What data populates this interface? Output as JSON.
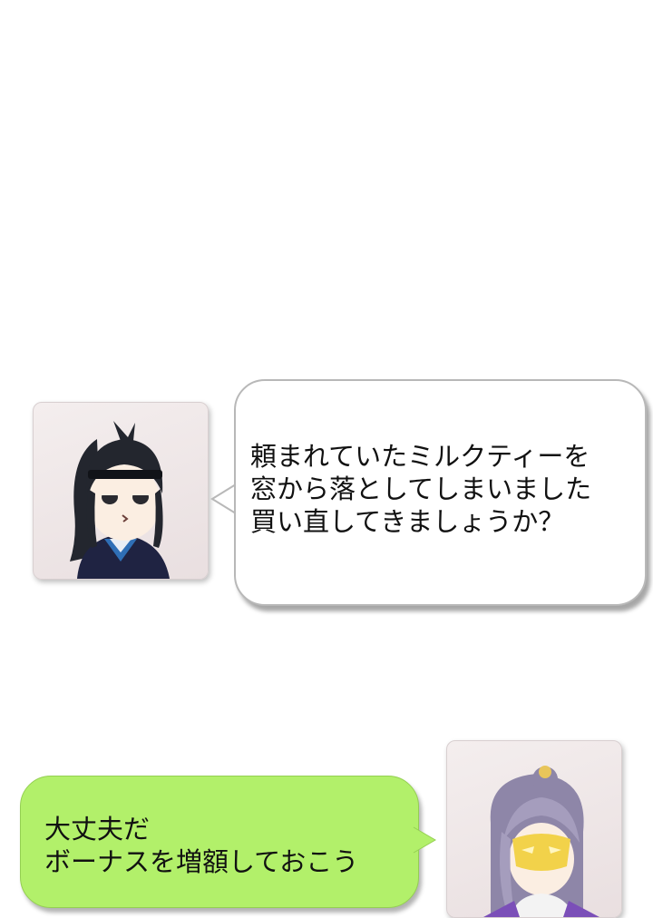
{
  "messages": [
    {
      "sender": "ponytail-character",
      "side": "left",
      "bubble_color": "#ffffff",
      "lines": [
        "頼まれていたミルクティーを",
        "窓から落としてしまいました",
        "買い直してきましょうか？"
      ]
    },
    {
      "sender": "masked-character",
      "side": "right",
      "bubble_color": "#b2f06a",
      "lines": [
        "大丈夫だ",
        "ボーナスを増額しておこう"
      ]
    }
  ]
}
